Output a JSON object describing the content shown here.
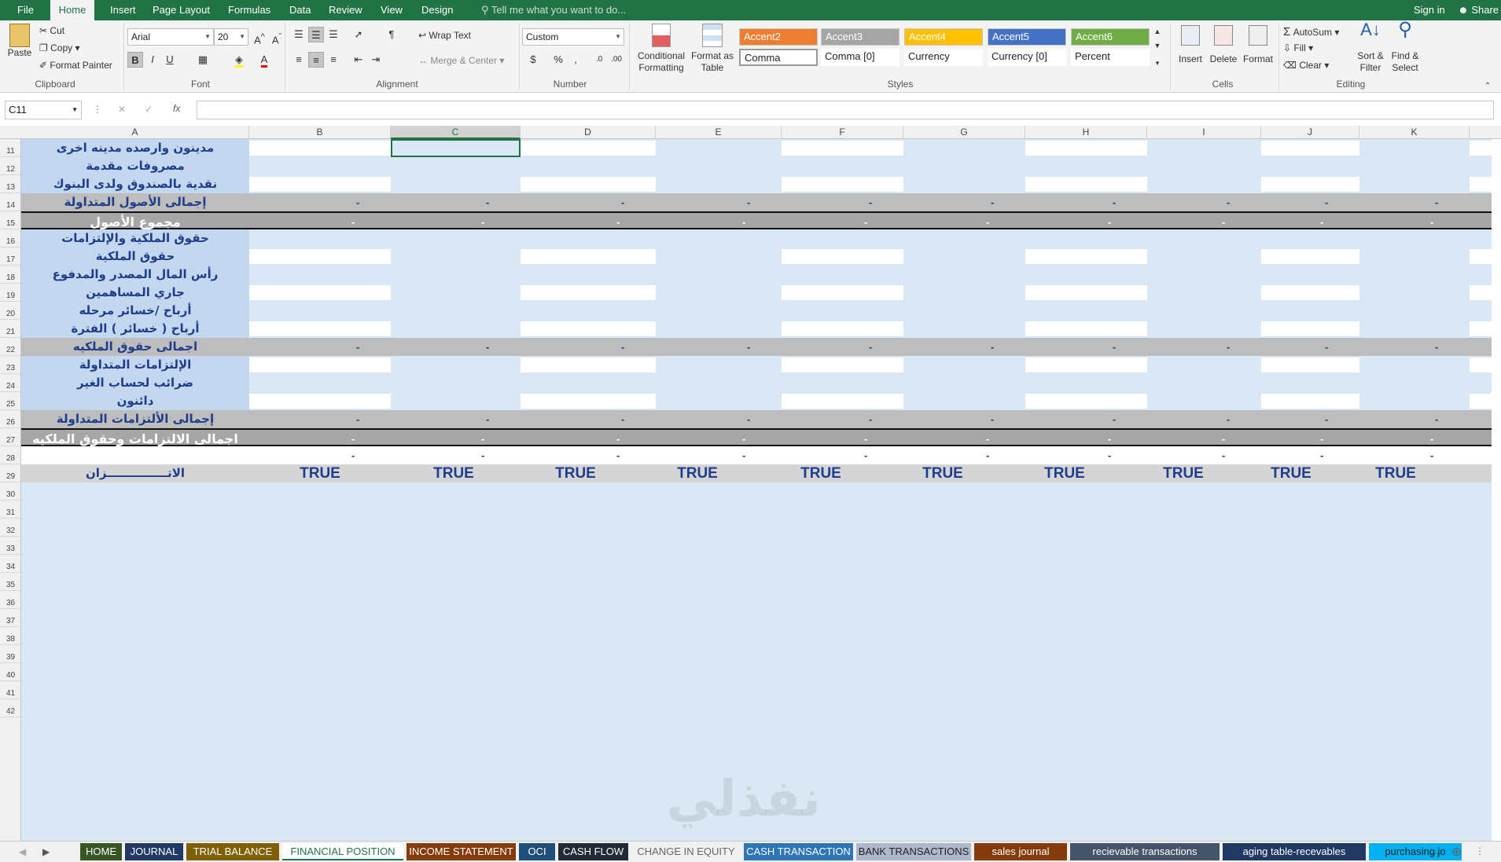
{
  "ribbon_tabs": [
    "File",
    "Home",
    "Insert",
    "Page Layout",
    "Formulas",
    "Data",
    "Review",
    "View",
    "Design"
  ],
  "active_tab": "Home",
  "tell_me": "Tell me what you want to do...",
  "sign_in": "Sign in",
  "share": "Share",
  "clipboard": {
    "paste": "Paste",
    "cut": "Cut",
    "copy": "Copy",
    "format_painter": "Format Painter",
    "label": "Clipboard"
  },
  "font": {
    "name": "Arial",
    "size": "20",
    "label": "Font",
    "bold": "B",
    "italic": "I",
    "underline": "U"
  },
  "alignment": {
    "wrap_text": "Wrap Text",
    "merge_center": "Merge & Center",
    "label": "Alignment"
  },
  "number": {
    "format": "Custom",
    "label": "Number"
  },
  "styles": {
    "conditional": "Conditional Formatting",
    "format_as_table": "Format as Table",
    "cells": [
      {
        "name": "Accent2",
        "color": "#ed7d31"
      },
      {
        "name": "Accent3",
        "color": "#a5a5a5"
      },
      {
        "name": "Accent4",
        "color": "#ffc000"
      },
      {
        "name": "Accent5",
        "color": "#4472c4"
      },
      {
        "name": "Accent6",
        "color": "#70ad47"
      }
    ],
    "row2": [
      "Comma",
      "Comma [0]",
      "Currency",
      "Currency [0]",
      "Percent"
    ],
    "label": "Styles"
  },
  "cells_group": {
    "insert": "Insert",
    "delete": "Delete",
    "format": "Format",
    "label": "Cells"
  },
  "editing": {
    "autosum": "AutoSum",
    "fill": "Fill",
    "clear": "Clear",
    "sort_filter": "Sort & Filter",
    "find_select": "Find & Select",
    "label": "Editing"
  },
  "name_box": "C11",
  "fx": "fx",
  "columns": [
    "A",
    "B",
    "C",
    "D",
    "E",
    "F",
    "G",
    "H",
    "I",
    "J",
    "K"
  ],
  "selected_column": "C",
  "rows": [
    {
      "num": "11",
      "type": "data",
      "label": "مدينون وارصده مدينه اخرى"
    },
    {
      "num": "12",
      "type": "data",
      "label": "مصروفات مقدمة"
    },
    {
      "num": "13",
      "type": "data",
      "label": "نقدية بالصندوق ولدى البنوك"
    },
    {
      "num": "14",
      "type": "subtotal",
      "label": "إجمالى الأصول المتداولة"
    },
    {
      "num": "15",
      "type": "total",
      "label": "مجموع الأصول"
    },
    {
      "num": "16",
      "type": "data",
      "label": "حقوق الملكية والإلتزامات"
    },
    {
      "num": "17",
      "type": "data",
      "label": "حقوق الملكية"
    },
    {
      "num": "18",
      "type": "data",
      "label": "رأس المال المصدر والمدفوع"
    },
    {
      "num": "19",
      "type": "data",
      "label": "جاري المساهمين"
    },
    {
      "num": "20",
      "type": "data",
      "label": "أرباح /خسائر مرحله"
    },
    {
      "num": "21",
      "type": "data",
      "label": "أرباح ( خسائر ) الفترة"
    },
    {
      "num": "22",
      "type": "subtotal",
      "label": "اجمالى حقوق الملكيه"
    },
    {
      "num": "23",
      "type": "data",
      "label": "الإلتزامات المتداولة"
    },
    {
      "num": "24",
      "type": "data",
      "label": "ضرائب لحساب الغير"
    },
    {
      "num": "25",
      "type": "data",
      "label": "دائنون"
    },
    {
      "num": "26",
      "type": "subtotal",
      "label": "إجمالى الألتزامات المتداولة"
    },
    {
      "num": "27",
      "type": "total",
      "label": "اجمالى الالتزامات وحقوق الملكيه"
    },
    {
      "num": "28",
      "type": "diff",
      "label": ""
    },
    {
      "num": "29",
      "type": "check",
      "label": "الاتـــــــــــــــزان"
    }
  ],
  "empty_rows": [
    "30",
    "31",
    "32",
    "33",
    "34",
    "35",
    "36",
    "37",
    "38",
    "39",
    "40",
    "41",
    "42"
  ],
  "dash": "-",
  "check_value": "TRUE",
  "watermark": "نفذلي",
  "sheet_tabs": [
    {
      "name": "HOME",
      "color": "#375623"
    },
    {
      "name": "JOURNAL",
      "color": "#203864"
    },
    {
      "name": "TRIAL BALANCE",
      "color": "#7f6000"
    },
    {
      "name": "FINANCIAL POSITION",
      "color": "#548235",
      "active": true
    },
    {
      "name": "INCOME STATEMENT",
      "color": "#843c0c"
    },
    {
      "name": "OCI",
      "color": "#1f4e79"
    },
    {
      "name": "CASH FLOW",
      "color": "#222a35"
    },
    {
      "name": "CHANGE IN EQUITY",
      "color": "#f0f0f0",
      "dark": true
    },
    {
      "name": "CASH TRANSACTION",
      "color": "#2e75b6"
    },
    {
      "name": "BANK TRANSACTIONS",
      "color": "#adb9ca",
      "dark": true
    },
    {
      "name": "sales journal",
      "color": "#843c0c"
    },
    {
      "name": "recievable transactions",
      "color": "#44546a"
    },
    {
      "name": "aging table-recevables",
      "color": "#203864"
    },
    {
      "name": "purchasing jo",
      "color": "#00b0f0",
      "dark": true
    }
  ],
  "more_tabs": "..."
}
